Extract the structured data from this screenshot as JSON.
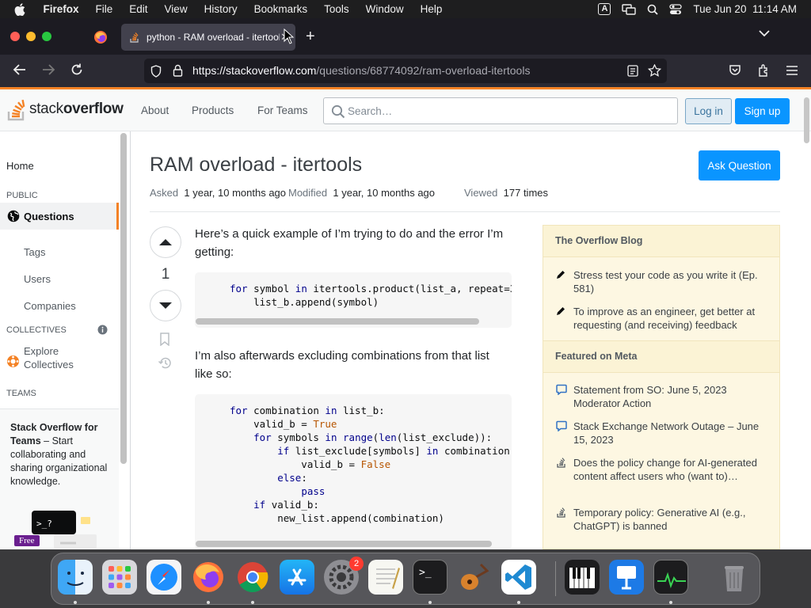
{
  "menubar": {
    "app": "Firefox",
    "items": [
      "File",
      "Edit",
      "View",
      "History",
      "Bookmarks",
      "Tools",
      "Window",
      "Help"
    ],
    "input_indicator": "A",
    "clock": "Tue Jun 20  11:14 AM"
  },
  "browser": {
    "tab_title": "python - RAM overload - itertools - Stack Overflow",
    "url_host": "https://stackoverflow.com",
    "url_path": "/questions/68774092/ram-overload-itertools"
  },
  "so_header": {
    "logo_plain": "stack",
    "logo_bold": "overflow",
    "nav": [
      "About",
      "Products",
      "For Teams"
    ],
    "search_placeholder": "Search…",
    "login": "Log in",
    "signup": "Sign up"
  },
  "leftnav": {
    "home": "Home",
    "public": "PUBLIC",
    "questions": "Questions",
    "tags": "Tags",
    "users": "Users",
    "companies": "Companies",
    "collectives": "COLLECTIVES",
    "explore": "Explore Collectives",
    "teams": "TEAMS",
    "teams_title": "Stack Overflow for Teams",
    "teams_text": " – Start collaborating and sharing organizational knowledge.",
    "free": "Free"
  },
  "question": {
    "title": "RAM overload - itertools",
    "ask_button": "Ask Question",
    "asked_label": "Asked",
    "asked_value": "1 year, 10 months ago",
    "modified_label": "Modified",
    "modified_value": "1 year, 10 months ago",
    "viewed_label": "Viewed",
    "viewed_value": "177 times",
    "score": "1",
    "para1": "Here’s a quick example of I’m trying to do and the error I’m getting:",
    "para2": "I’m also afterwards excluding combinations from that list like so:"
  },
  "sidebar": {
    "blog_header": "The Overflow Blog",
    "blog_items": [
      "Stress test your code as you write it (Ep. 581)",
      "To improve as an engineer, get better at requesting (and receiving) feedback"
    ],
    "meta_header": "Featured on Meta",
    "meta_items": [
      "Statement from SO: June 5, 2023 Moderator Action",
      "Stack Exchange Network Outage – June 15, 2023",
      "Does the policy change for AI-generated content affect users who (want to)…",
      "Temporary policy: Generative AI (e.g., ChatGPT) is banned"
    ]
  },
  "dock": {
    "settings_badge": "2",
    "terminal_prompt": ">_"
  },
  "colors": {
    "so_orange": "#f48225",
    "so_blue": "#0a95ff",
    "sidebar_bg": "#fdf7e2"
  }
}
